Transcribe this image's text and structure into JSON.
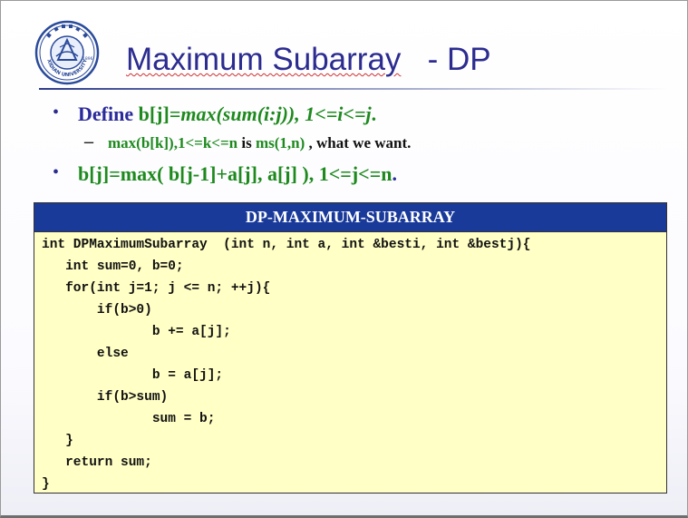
{
  "title": {
    "main": "Maximum Subarray",
    "suffix": "   - DP"
  },
  "bullets": {
    "b1": {
      "prefix": "Define ",
      "expr": "b[j]",
      "eq": "=",
      "formula": "max(sum(i:j)), 1<=i<=j",
      "end": "."
    },
    "b2": {
      "part1": "max(b[k]),1<=k<=n",
      "part2": " is ",
      "part3": "ms(1,n)",
      "part4": " , what we want."
    },
    "b3": {
      "text": "b[j]=max( b[j-1]+a[j], a[j] ), 1<=j<=n",
      "end": "."
    }
  },
  "code_panel": {
    "header": "DP-MAXIMUM-SUBARRAY",
    "lines": [
      "int DPMaximumSubarray  (int n, int a, int &besti, int &bestj){",
      "   int sum=0, b=0;",
      "   for(int j=1; j <= n; ++j){",
      "       if(b>0)",
      "              b += a[j];",
      "       else",
      "              b = a[j];",
      "       if(b>sum)",
      "              sum = b;",
      "   }",
      "   return sum;",
      "}"
    ]
  },
  "logo": {
    "year": "1896",
    "text_bottom": "XIDIAN UNIVERSITY"
  },
  "colors": {
    "title": "#2c2c90",
    "text_blue": "#2a2a9a",
    "text_green": "#1e8a1e",
    "panel_header": "#1a3a9a",
    "panel_bg": "#ffffc6"
  }
}
